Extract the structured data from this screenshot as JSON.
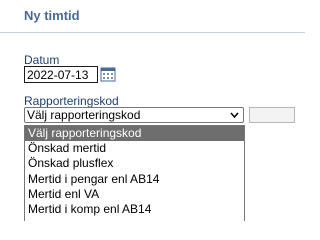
{
  "header": {
    "title": "Ny timtid"
  },
  "form": {
    "date_label": "Datum",
    "date_value": "2022-07-13",
    "code_label": "Rapporteringskod",
    "code_selected": "Välj rapporteringskod"
  },
  "dropdown": {
    "options": [
      "Välj rapporteringskod",
      "Önskad mertid",
      "Önskad plusflex",
      "Mertid i pengar enl AB14",
      "Mertid enl VA",
      "Mertid i komp enl AB14"
    ],
    "highlighted_index": 0
  },
  "colors": {
    "title": "#4a6a96",
    "label": "#1f3f6a",
    "highlight": "#6e6e6e"
  }
}
